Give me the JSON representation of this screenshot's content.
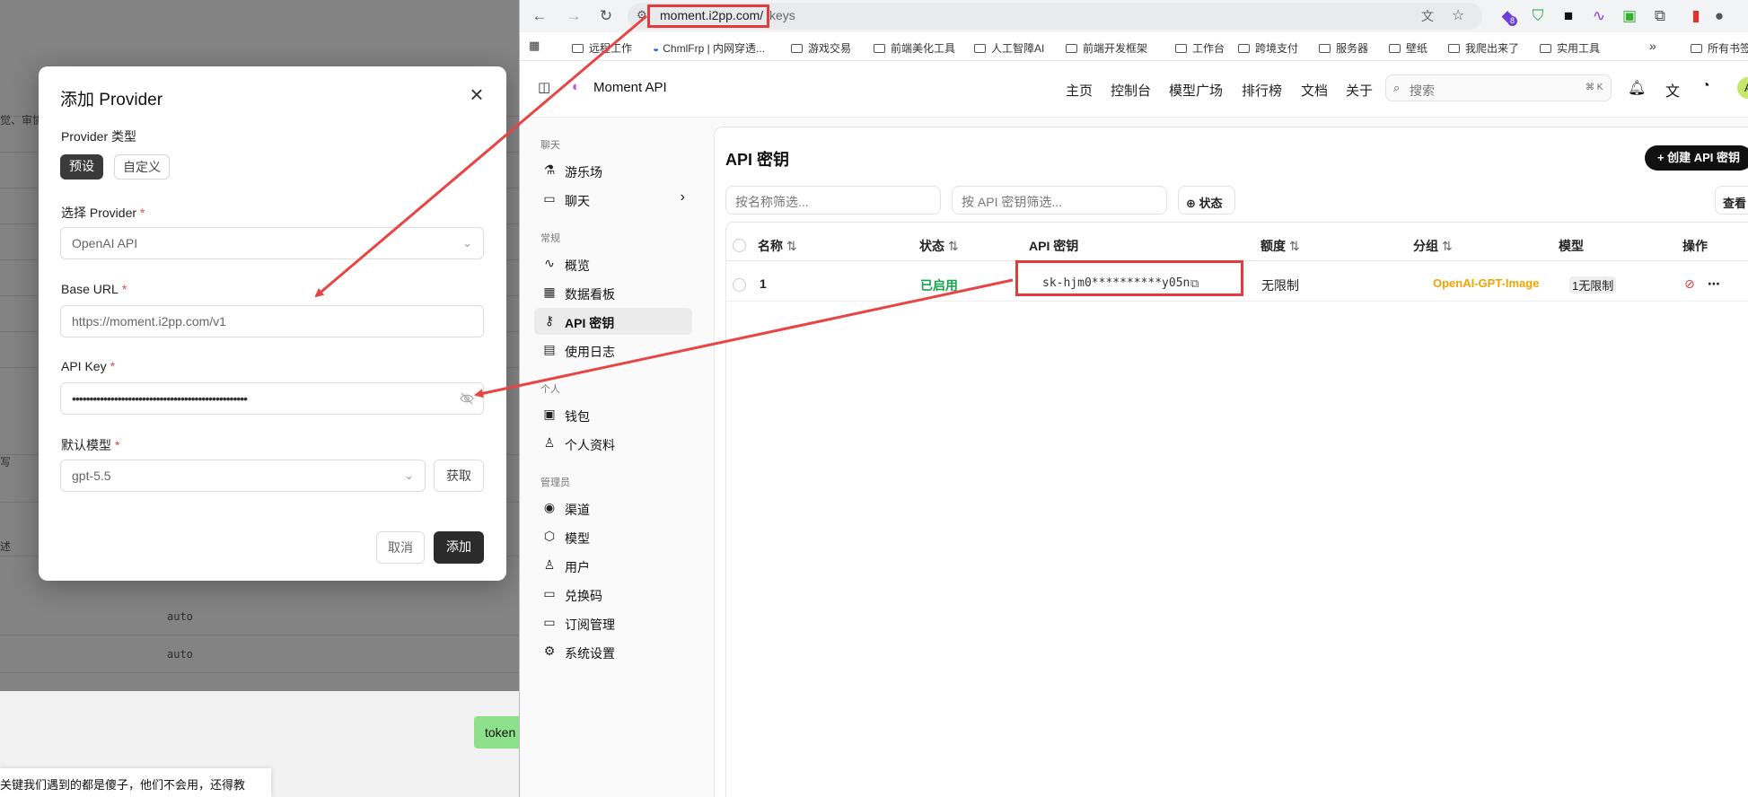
{
  "bg": {
    "row_texts": [
      "觉、审协",
      "写",
      "述",
      "auto",
      "auto"
    ],
    "token_label": "token",
    "chat_text": "关键我们遇到的都是傻子，他们不会用，还得教"
  },
  "dialog": {
    "title": "添加 Provider",
    "close_icon": "×",
    "provider_type_label": "Provider 类型",
    "tab_preset": "预设",
    "tab_custom": "自定义",
    "select_provider_label": "选择 Provider",
    "required_mark": "*",
    "provider_value": "OpenAI API",
    "base_url_label": "Base URL",
    "base_url_value": "https://moment.i2pp.com/v1",
    "api_key_label": "API Key",
    "api_key_masked": "••••••••••••••••••••••••••••••••••••••••••••••••••",
    "default_model_label": "默认模型",
    "default_model_value": "gpt-5.5",
    "fetch_button": "获取",
    "cancel_button": "取消",
    "add_button": "添加"
  },
  "browser": {
    "url_host": "moment.i2pp.com/",
    "url_path": "keys",
    "bookmarks": [
      "远程工作",
      "ChmlFrp | 内网穿透...",
      "游戏交易",
      "前端美化工具",
      "人工智障AI",
      "前端开发框架",
      "工作台",
      "跨境支付",
      "服务器",
      "壁纸",
      "我爬出来了",
      "实用工具",
      "所有书签"
    ],
    "overflow": "»",
    "ext_badge": "8"
  },
  "app": {
    "brand": "Moment API",
    "nav": [
      "主页",
      "控制台",
      "模型广场",
      "排行榜",
      "文档",
      "关于"
    ],
    "search_placeholder": "搜索",
    "search_shortcut": "⌘ K",
    "avatar": "A",
    "sidebar": {
      "sections": [
        {
          "title": "聊天",
          "items": [
            "游乐场",
            "聊天"
          ]
        },
        {
          "title": "常规",
          "items": [
            "概览",
            "数据看板",
            "API 密钥",
            "使用日志"
          ]
        },
        {
          "title": "个人",
          "items": [
            "钱包",
            "个人资料"
          ]
        },
        {
          "title": "管理员",
          "items": [
            "渠道",
            "模型",
            "用户",
            "兑换码",
            "订阅管理",
            "系统设置"
          ]
        }
      ]
    },
    "page_title": "API 密钥",
    "create_button": "+ 创建 API 密钥",
    "filter_name_placeholder": "按名称筛选...",
    "filter_key_placeholder": "按 API 密钥筛选...",
    "status_filter": "状态",
    "view_button": "查看",
    "table": {
      "headers": [
        "名称",
        "状态",
        "API 密钥",
        "额度",
        "分组",
        "模型",
        "操作"
      ],
      "rows": [
        {
          "name": "1",
          "status": "已启用",
          "key": "sk-hjm0**********y05n",
          "quota": "无限制",
          "group": "OpenAI-GPT-Image",
          "models_count": "1",
          "models": "无限制"
        }
      ]
    },
    "colors": {
      "accent_red": "#e23b3b",
      "status_green": "#1aa251",
      "group_orange": "#f0a400"
    }
  }
}
